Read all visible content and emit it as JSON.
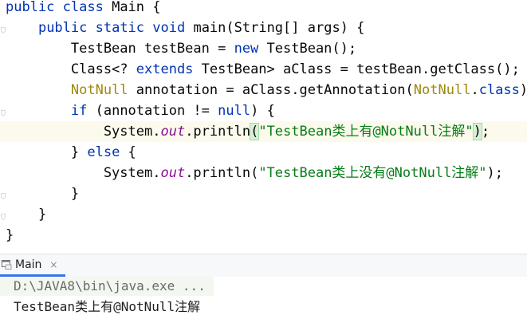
{
  "editor": {
    "lines": [
      {
        "segments": [
          {
            "t": "public ",
            "c": "kw"
          },
          {
            "t": "class ",
            "c": "kw"
          },
          {
            "t": "Main {",
            "c": "plain"
          }
        ]
      },
      {
        "segments": [
          {
            "t": "    ",
            "c": "plain"
          },
          {
            "t": "public ",
            "c": "kw"
          },
          {
            "t": "static ",
            "c": "kw"
          },
          {
            "t": "void ",
            "c": "kw"
          },
          {
            "t": "main(String[] args) {",
            "c": "plain"
          }
        ]
      },
      {
        "segments": [
          {
            "t": "        TestBean testBean = ",
            "c": "plain"
          },
          {
            "t": "new ",
            "c": "kw"
          },
          {
            "t": "TestBean();",
            "c": "plain"
          }
        ]
      },
      {
        "segments": [
          {
            "t": "        Class<? ",
            "c": "plain"
          },
          {
            "t": "extends ",
            "c": "kw"
          },
          {
            "t": "TestBean> aClass = testBean.getClass();",
            "c": "plain"
          }
        ]
      },
      {
        "segments": [
          {
            "t": "        ",
            "c": "plain"
          },
          {
            "t": "NotNull",
            "c": "ann"
          },
          {
            "t": " annotation = aClass.getAnnotation(",
            "c": "plain"
          },
          {
            "t": "NotNull",
            "c": "ann"
          },
          {
            "t": ".",
            "c": "plain"
          },
          {
            "t": "class",
            "c": "kw"
          },
          {
            "t": ");",
            "c": "plain"
          }
        ]
      },
      {
        "segments": [
          {
            "t": "        ",
            "c": "plain"
          },
          {
            "t": "if ",
            "c": "kw"
          },
          {
            "t": "(annotation != ",
            "c": "plain"
          },
          {
            "t": "null",
            "c": "kw"
          },
          {
            "t": ") {",
            "c": "plain"
          }
        ]
      },
      {
        "segments": [
          {
            "t": "            System.",
            "c": "plain"
          },
          {
            "t": "out",
            "c": "fld"
          },
          {
            "t": ".println",
            "c": "plain"
          },
          {
            "t": "(",
            "c": "plain brace-match"
          },
          {
            "t": "\"TestBean类上有@NotNull注解\"",
            "c": "str"
          },
          {
            "t": ")",
            "c": "plain brace-match"
          },
          {
            "t": ";",
            "c": "plain"
          }
        ],
        "current": true
      },
      {
        "segments": [
          {
            "t": "        } ",
            "c": "plain"
          },
          {
            "t": "else ",
            "c": "kw"
          },
          {
            "t": "{",
            "c": "plain"
          }
        ]
      },
      {
        "segments": [
          {
            "t": "            System.",
            "c": "plain"
          },
          {
            "t": "out",
            "c": "fld"
          },
          {
            "t": ".println(",
            "c": "plain"
          },
          {
            "t": "\"TestBean类上没有@NotNull注解\"",
            "c": "str"
          },
          {
            "t": ");",
            "c": "plain"
          }
        ]
      },
      {
        "segments": [
          {
            "t": "        }",
            "c": "plain"
          }
        ]
      },
      {
        "segments": [
          {
            "t": "    }",
            "c": "plain"
          }
        ]
      },
      {
        "segments": [
          {
            "t": "}",
            "c": "plain"
          }
        ]
      }
    ]
  },
  "run_panel": {
    "tab_label": "Main",
    "close_glyph": "×",
    "console": {
      "command": "D:\\JAVA8\\bin\\java.exe ...",
      "output": "TestBean类上有@NotNull注解"
    }
  },
  "colors": {
    "keyword": "#0033b3",
    "string": "#067d17",
    "annotation": "#9e880d",
    "field": "#871094",
    "current_line": "#fcfaed",
    "tab_underline": "#3574f0"
  },
  "icons": {
    "fold_markers": "fold-marker-icon",
    "run_tab": "java-run-config-icon",
    "close": "close-icon"
  }
}
